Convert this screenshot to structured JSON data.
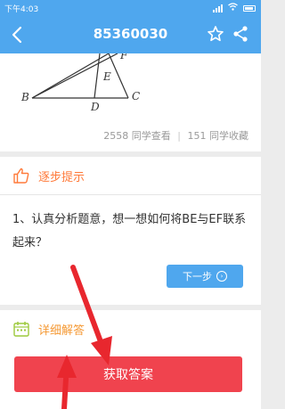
{
  "status_bar": {
    "time": "下午4:03"
  },
  "header": {
    "title": "85360030"
  },
  "figure": {
    "labels": {
      "B": "B",
      "C": "C",
      "D": "D",
      "E": "E",
      "F": "F"
    }
  },
  "stats": {
    "views": "2558 同学查看",
    "separator": "|",
    "favorites": "151 同学收藏"
  },
  "hint_section": {
    "title": "逐步提示",
    "text": "1、认真分析题意，想一想如何将BE与EF联系起来？",
    "next_label": "下一步"
  },
  "answer_section": {
    "title": "详细解答",
    "button_label": "获取答案"
  },
  "colors": {
    "accent": "#4fa7ee",
    "hint_title": "#ff7a3a",
    "answer_button": "#f0434e",
    "annotation_arrow": "#e8272e"
  },
  "icons": [
    "back-icon",
    "star-icon",
    "share-icon",
    "thumbs-up-icon",
    "calendar-icon",
    "chevron-right-icon"
  ]
}
